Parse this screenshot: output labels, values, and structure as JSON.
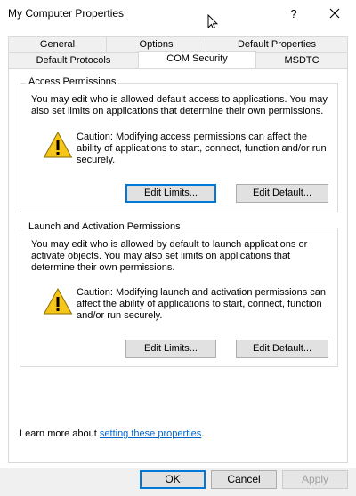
{
  "window": {
    "title": "My Computer Properties",
    "help_glyph": "?",
    "close_icon": "close-icon"
  },
  "tabs": {
    "row1": [
      "General",
      "Options",
      "Default Properties"
    ],
    "row2": [
      "Default Protocols",
      "COM Security",
      "MSDTC"
    ],
    "active": "COM Security"
  },
  "access": {
    "legend": "Access Permissions",
    "description": "You may edit who is allowed default access to applications. You may also set limits on applications that determine their own permissions.",
    "caution": "Caution: Modifying access permissions can affect the ability of applications to start, connect, function and/or run securely.",
    "edit_limits": "Edit Limits...",
    "edit_default": "Edit Default..."
  },
  "launch": {
    "legend": "Launch and Activation Permissions",
    "description": "You may edit who is allowed by default to launch applications or activate objects. You may also set limits on applications that determine their own permissions.",
    "caution": "Caution: Modifying launch and activation permissions can affect the ability of applications to start, connect, function and/or run securely.",
    "edit_limits": "Edit Limits...",
    "edit_default": "Edit Default..."
  },
  "learn_more": {
    "prefix": "Learn more about ",
    "link": "setting these properties",
    "suffix": "."
  },
  "footer": {
    "ok": "OK",
    "cancel": "Cancel",
    "apply": "Apply"
  },
  "colors": {
    "accent": "#0078d7",
    "link": "#0066cc",
    "warning": "#f5c518"
  }
}
